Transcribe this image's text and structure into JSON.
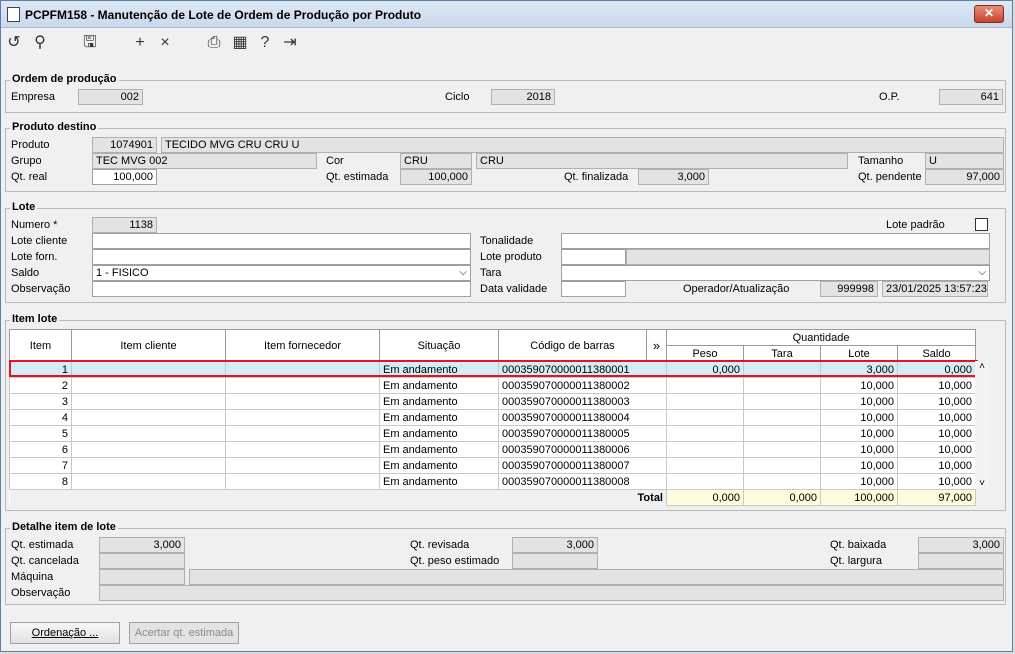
{
  "window": {
    "title": "PCPFM158 - Manutenção de Lote de Ordem de Produção por Produto",
    "close": "✕"
  },
  "toolbar": {
    "icons": [
      "undo-icon",
      "search-icon",
      "save-icon",
      "add-icon",
      "delete-icon",
      "print-icon",
      "calendar-icon",
      "help-icon",
      "exit-icon"
    ]
  },
  "ordem": {
    "label": "Ordem de produção",
    "empresa_label": "Empresa",
    "empresa": "002",
    "ciclo_label": "Ciclo",
    "ciclo": "2018",
    "op_label": "O.P.",
    "op": "641"
  },
  "produto": {
    "label": "Produto destino",
    "produto_label": "Produto",
    "produto_code": "1074901",
    "produto_desc": "TECIDO MVG CRU CRU U",
    "grupo_label": "Grupo",
    "grupo": "TEC MVG 002",
    "cor_label": "Cor",
    "cor_code": "CRU",
    "cor_desc": "CRU",
    "tamanho_label": "Tamanho",
    "tamanho": "U",
    "qt_real_label": "Qt. real",
    "qt_real": "100,000",
    "qt_estimada_label": "Qt. estimada",
    "qt_estimada": "100,000",
    "qt_finalizada_label": "Qt. finalizada",
    "qt_finalizada": "3,000",
    "qt_pendente_label": "Qt. pendente",
    "qt_pendente": "97,000"
  },
  "lote": {
    "label": "Lote",
    "numero_label": "Numero *",
    "numero": "1138",
    "lote_padrao_label": "Lote padrão",
    "lote_cliente_label": "Lote cliente",
    "tonalidade_label": "Tonalidade",
    "lote_forn_label": "Lote forn.",
    "lote_produto_label": "Lote produto",
    "saldo_label": "Saldo",
    "saldo": "1 - FISICO",
    "tara_label": "Tara",
    "observacao_label": "Observação",
    "data_validade_label": "Data validade",
    "operador_label": "Operador/Atualização",
    "operador": "999998",
    "atualizacao": "23/01/2025 13:57:23"
  },
  "itens": {
    "label": "Item lote",
    "headers": {
      "item": "Item",
      "item_cliente": "Item cliente",
      "item_fornecedor": "Item fornecedor",
      "situacao": "Situação",
      "codigo": "Código de barras",
      "more": "»",
      "quantidade": "Quantidade",
      "peso": "Peso",
      "tara": "Tara",
      "lote": "Lote",
      "saldo": "Saldo"
    },
    "rows": [
      {
        "item": "1",
        "situacao": "Em andamento",
        "codigo": "000359070000011380001",
        "peso": "0,000",
        "tara": "",
        "lote": "3,000",
        "saldo": "0,000"
      },
      {
        "item": "2",
        "situacao": "Em andamento",
        "codigo": "000359070000011380002",
        "peso": "",
        "tara": "",
        "lote": "10,000",
        "saldo": "10,000"
      },
      {
        "item": "3",
        "situacao": "Em andamento",
        "codigo": "000359070000011380003",
        "peso": "",
        "tara": "",
        "lote": "10,000",
        "saldo": "10,000"
      },
      {
        "item": "4",
        "situacao": "Em andamento",
        "codigo": "000359070000011380004",
        "peso": "",
        "tara": "",
        "lote": "10,000",
        "saldo": "10,000"
      },
      {
        "item": "5",
        "situacao": "Em andamento",
        "codigo": "000359070000011380005",
        "peso": "",
        "tara": "",
        "lote": "10,000",
        "saldo": "10,000"
      },
      {
        "item": "6",
        "situacao": "Em andamento",
        "codigo": "000359070000011380006",
        "peso": "",
        "tara": "",
        "lote": "10,000",
        "saldo": "10,000"
      },
      {
        "item": "7",
        "situacao": "Em andamento",
        "codigo": "000359070000011380007",
        "peso": "",
        "tara": "",
        "lote": "10,000",
        "saldo": "10,000"
      },
      {
        "item": "8",
        "situacao": "Em andamento",
        "codigo": "000359070000011380008",
        "peso": "",
        "tara": "",
        "lote": "10,000",
        "saldo": "10,000"
      }
    ],
    "total": {
      "label": "Total",
      "peso": "0,000",
      "tara": "0,000",
      "lote": "100,000",
      "saldo": "97,000"
    }
  },
  "detalhe": {
    "label": "Detalhe item de lote",
    "qt_estimada_label": "Qt. estimada",
    "qt_estimada": "3,000",
    "qt_revisada_label": "Qt. revisada",
    "qt_revisada": "3,000",
    "qt_baixada_label": "Qt. baixada",
    "qt_baixada": "3,000",
    "qt_cancelada_label": "Qt. cancelada",
    "qt_peso_estimado_label": "Qt. peso estimado",
    "qt_largura_label": "Qt. largura",
    "maquina_label": "Máquina",
    "observacao_label": "Observação"
  },
  "buttons": {
    "ordenacao": "Ordenação ...",
    "acertar": "Acertar qt. estimada"
  }
}
